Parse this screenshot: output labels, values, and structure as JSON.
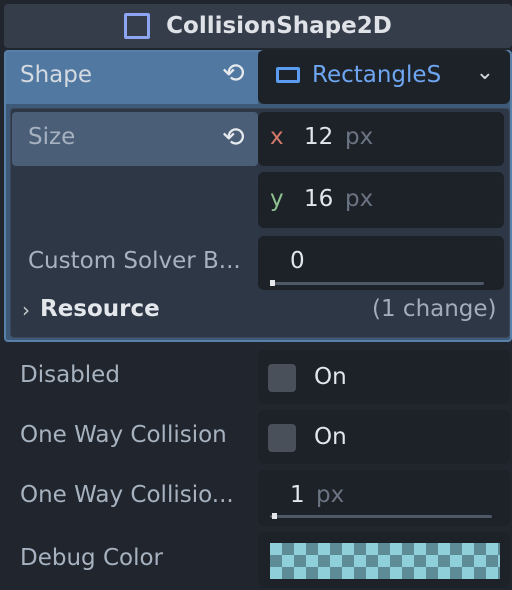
{
  "header": {
    "icon": "collision-rect-icon",
    "title": "CollisionShape2D"
  },
  "shape": {
    "label": "Shape",
    "value": "RectangleS"
  },
  "size": {
    "label": "Size",
    "x_axis": "x",
    "x_value": "12",
    "x_unit": "px",
    "y_axis": "y",
    "y_value": "16",
    "y_unit": "px"
  },
  "custom_solver": {
    "label": "Custom Solver B...",
    "value": "0"
  },
  "resource": {
    "label": "Resource",
    "changes": "(1 change)"
  },
  "disabled": {
    "label": "Disabled",
    "value": "On"
  },
  "one_way_collision": {
    "label": "One Way Collision",
    "value": "On"
  },
  "one_way_margin": {
    "label": "One Way Collisio...",
    "value": "1",
    "unit": "px"
  },
  "debug_color": {
    "label": "Debug Color",
    "color": "#8fcfd9"
  }
}
